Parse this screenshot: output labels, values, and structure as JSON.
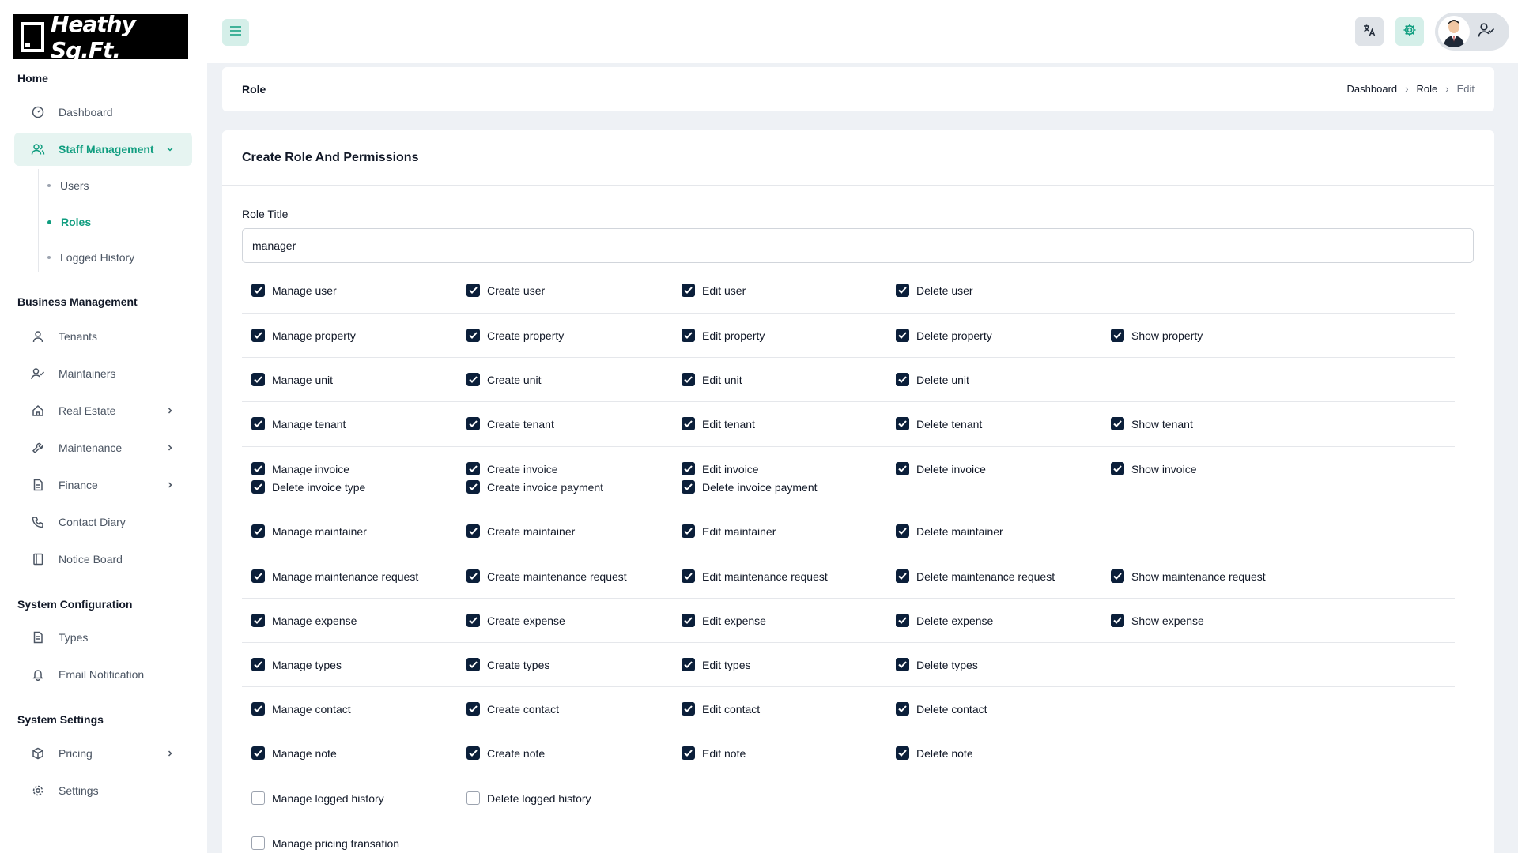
{
  "brand": {
    "name": "Heathy Sq.Ft."
  },
  "colors": {
    "accent": "#0f9d7f",
    "checkbox": "#0b1f3a"
  },
  "sidebar": {
    "sections": [
      {
        "title": "Home"
      },
      {
        "title": "Business Management"
      },
      {
        "title": "System Configuration"
      },
      {
        "title": "System Settings"
      }
    ],
    "items": {
      "dashboard": "Dashboard",
      "staff": "Staff Management",
      "users": "Users",
      "roles": "Roles",
      "logged": "Logged History",
      "tenants": "Tenants",
      "maintainers": "Maintainers",
      "realestate": "Real Estate",
      "maintenance": "Maintenance",
      "finance": "Finance",
      "contact": "Contact Diary",
      "notice": "Notice Board",
      "types": "Types",
      "email": "Email Notification",
      "pricing": "Pricing",
      "settings": "Settings"
    }
  },
  "header": {
    "page_title": "Role"
  },
  "breadcrumb": [
    "Dashboard",
    "Role",
    "Edit"
  ],
  "form": {
    "heading": "Create Role And Permissions",
    "role_title_label": "Role Title",
    "role_title_value": "manager"
  },
  "permissions": [
    [
      "Manage user",
      "Create user",
      "Edit user",
      "Delete user"
    ],
    [
      "Manage property",
      "Create property",
      "Edit property",
      "Delete property",
      "Show property"
    ],
    [
      "Manage unit",
      "Create unit",
      "Edit unit",
      "Delete unit"
    ],
    [
      "Manage tenant",
      "Create tenant",
      "Edit tenant",
      "Delete tenant",
      "Show tenant"
    ],
    [
      "Manage invoice",
      "Create invoice",
      "Edit invoice",
      "Delete invoice",
      "Show invoice",
      "Delete invoice type",
      "Create invoice payment",
      "Delete invoice payment"
    ],
    [
      "Manage maintainer",
      "Create maintainer",
      "Edit maintainer",
      "Delete maintainer"
    ],
    [
      "Manage maintenance request",
      "Create maintenance request",
      "Edit maintenance request",
      "Delete maintenance request",
      "Show maintenance request"
    ],
    [
      "Manage expense",
      "Create expense",
      "Edit expense",
      "Delete expense",
      "Show expense"
    ],
    [
      "Manage types",
      "Create types",
      "Edit types",
      "Delete types"
    ],
    [
      "Manage contact",
      "Create contact",
      "Edit contact",
      "Delete contact"
    ],
    [
      "Manage note",
      "Create note",
      "Edit note",
      "Delete note"
    ],
    [
      "Manage logged history",
      "Delete logged history"
    ],
    [
      "Manage pricing transation"
    ]
  ],
  "unchecked_rows": [
    11,
    12
  ]
}
